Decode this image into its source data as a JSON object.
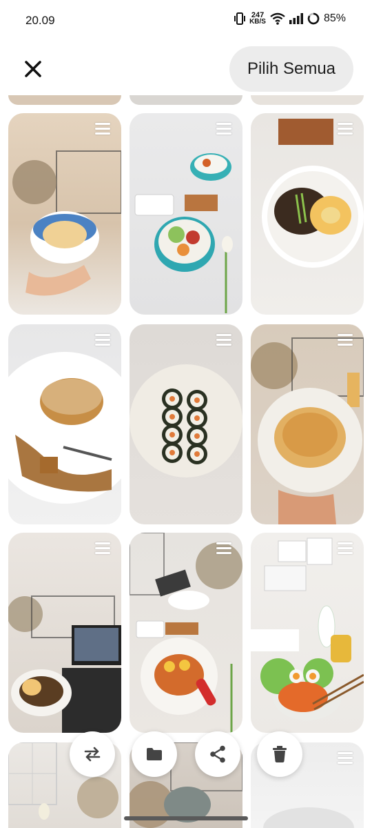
{
  "status_bar": {
    "time": "20.09",
    "net_speed_value": "247",
    "net_speed_unit": "KB/S",
    "battery": "85%",
    "icons": [
      "vibrate-icon",
      "wifi-icon",
      "signal-icon",
      "battery-icon"
    ]
  },
  "header": {
    "close_icon": "close-icon",
    "select_all_label": "Pilih Semua"
  },
  "gallery": {
    "items": [
      {
        "desc": "dumplings bowl",
        "colors": [
          "#d9c7b3",
          "#4d86c7",
          "#f1d39a"
        ]
      },
      {
        "desc": "bibimbap bowls with clock",
        "colors": [
          "#e9e9ea",
          "#36b2b0",
          "#f1f1f1"
        ]
      },
      {
        "desc": "noodles with fried egg",
        "colors": [
          "#ebe9e6",
          "#3c2a1d",
          "#f2c361"
        ]
      },
      {
        "desc": "sesame pancake with syrup",
        "colors": [
          "#efeeee",
          "#c88e45",
          "#8a5a22"
        ]
      },
      {
        "desc": "kimbap rolls",
        "colors": [
          "#dfdad6",
          "#f1ede6",
          "#2d3322"
        ]
      },
      {
        "desc": "potato pancake",
        "colors": [
          "#d9cdbf",
          "#f1eee8",
          "#e1b061"
        ]
      },
      {
        "desc": "noodles with laptop",
        "colors": [
          "#d8d2cb",
          "#2c2c2c",
          "#f3c574"
        ]
      },
      {
        "desc": "tteokbokki with eggs",
        "colors": [
          "#ececec",
          "#e9e4de",
          "#d36b2c"
        ]
      },
      {
        "desc": "rabokki with lettuce",
        "colors": [
          "#f1efec",
          "#7cc151",
          "#e46a2a"
        ]
      },
      {
        "desc": "partial tile 1",
        "colors": [
          "#e8e5e1",
          "#f3f1ee",
          "#c9b79f"
        ]
      },
      {
        "desc": "partial tile 2",
        "colors": [
          "#d9d3cc",
          "#a89276",
          "#f0ebe4"
        ]
      },
      {
        "desc": "partial tile 3",
        "colors": [
          "#ececec",
          "#f5f5f5",
          "#d7d7d7"
        ]
      }
    ]
  },
  "actions": [
    {
      "name": "swap-icon",
      "label": "swap"
    },
    {
      "name": "folder-icon",
      "label": "move"
    },
    {
      "name": "share-icon",
      "label": "share"
    },
    {
      "name": "trash-icon",
      "label": "delete"
    }
  ]
}
